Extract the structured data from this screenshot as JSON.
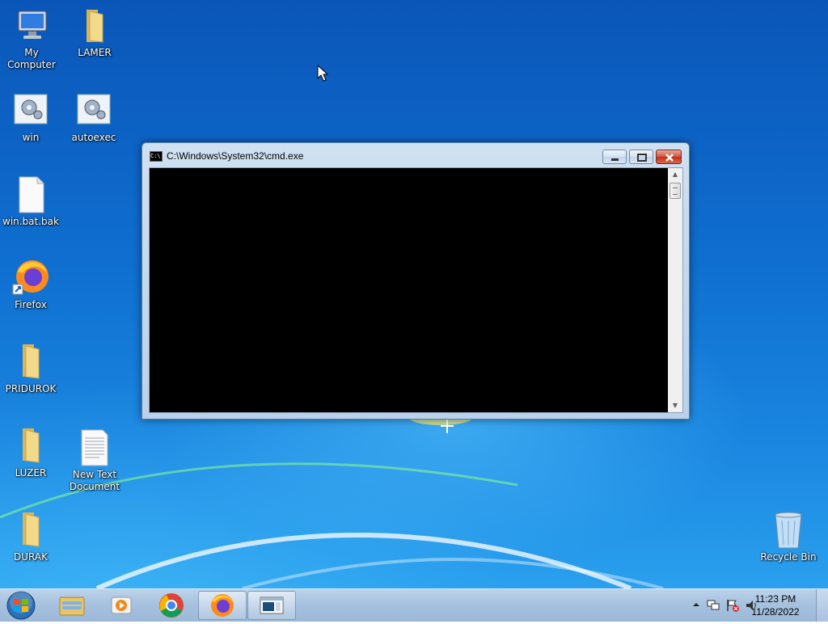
{
  "desktop": {
    "icons": [
      {
        "label": "My Computer"
      },
      {
        "label": "LAMER"
      },
      {
        "label": "win"
      },
      {
        "label": "autoexec"
      },
      {
        "label": "win.bat.bak"
      },
      {
        "label": "Firefox"
      },
      {
        "label": "PRIDUROK"
      },
      {
        "label": "LUZER"
      },
      {
        "label": "New Text Document"
      },
      {
        "label": "DURAK"
      },
      {
        "label": "Recycle Bin"
      }
    ]
  },
  "cmd_window": {
    "title": "C:\\Windows\\System32\\cmd.exe",
    "title_icon_text": "C:\\"
  },
  "taskbar": {
    "pinned": [
      "start-orb-icon",
      "file-explorer-icon",
      "media-player-icon",
      "chrome-icon",
      "firefox-icon",
      "cmd-icon"
    ],
    "clock": {
      "time": "11:23 PM",
      "date": "11/28/2022"
    }
  },
  "colors": {
    "desktop_top": "#0a56b8",
    "desktop_bottom": "#2aa0ee",
    "console_bg": "#000000",
    "close_button": "#c0301b"
  }
}
